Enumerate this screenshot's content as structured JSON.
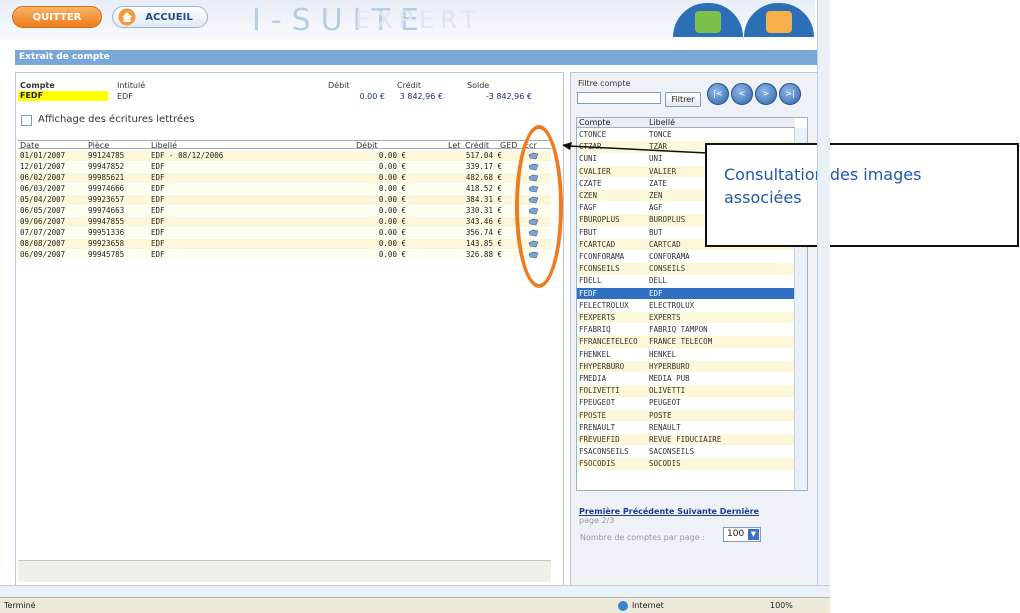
{
  "header": {
    "quit_label": "QUITTER",
    "home_label": "ACCUEIL",
    "brand": "I-SUITE",
    "brand_sub": "EXPERT"
  },
  "page": {
    "title": "Extrait de compte"
  },
  "account": {
    "labels": {
      "compte": "Compte",
      "intitule": "Intitulé",
      "debit": "Débit",
      "credit": "Crédit",
      "solde": "Solde"
    },
    "code": "FEDF",
    "name": "EDF",
    "debit": "0.00 €",
    "credit": "3 842,96 €",
    "solde": "-3 842,96 €"
  },
  "lettered_checkbox_label": "Affichage des écritures lettrées",
  "entries": {
    "columns": {
      "date": "Date",
      "piece": "Pièce",
      "libelle": "Libellé",
      "debit": "Débit",
      "let": "Let",
      "credit": "Crédit",
      "ged": "GED",
      "ecr": "Ecr"
    },
    "rows": [
      {
        "date": "01/01/2007",
        "piece": "99124785",
        "libelle": "EDF - 08/12/2006",
        "debit": "0.00 €",
        "credit": "517.04 €"
      },
      {
        "date": "12/01/2007",
        "piece": "99947852",
        "libelle": "EDF",
        "debit": "0.00 €",
        "credit": "339.17 €"
      },
      {
        "date": "06/02/2007",
        "piece": "99985621",
        "libelle": "EDF",
        "debit": "0.00 €",
        "credit": "482.68 €"
      },
      {
        "date": "06/03/2007",
        "piece": "99974666",
        "libelle": "EDF",
        "debit": "0.00 €",
        "credit": "418.52 €"
      },
      {
        "date": "05/04/2007",
        "piece": "99923657",
        "libelle": "EDF",
        "debit": "0.00 €",
        "credit": "384.31 €"
      },
      {
        "date": "06/05/2007",
        "piece": "99974663",
        "libelle": "EDF",
        "debit": "0.00 €",
        "credit": "330.31 €"
      },
      {
        "date": "09/06/2007",
        "piece": "99947855",
        "libelle": "EDF",
        "debit": "0.00 €",
        "credit": "343.46 €"
      },
      {
        "date": "07/07/2007",
        "piece": "99951336",
        "libelle": "EDF",
        "debit": "0.00 €",
        "credit": "356.74 €"
      },
      {
        "date": "08/08/2007",
        "piece": "99923658",
        "libelle": "EDF",
        "debit": "0.00 €",
        "credit": "143.85 €"
      },
      {
        "date": "06/09/2007",
        "piece": "99945785",
        "libelle": "EDF",
        "debit": "0.00 €",
        "credit": "326.88 €"
      }
    ]
  },
  "filter": {
    "label": "Filtre compte",
    "button": "Filtrer",
    "input_value": ""
  },
  "account_list": {
    "columns": {
      "compte": "Compte",
      "libelle": "Libellé"
    },
    "selected_code": "FEDF",
    "rows": [
      {
        "code": "CTONCE",
        "label": "TONCE"
      },
      {
        "code": "CTZAR",
        "label": "TZAR"
      },
      {
        "code": "CUNI",
        "label": "UNI"
      },
      {
        "code": "CVALIER",
        "label": "VALIER"
      },
      {
        "code": "CZATE",
        "label": "ZATE"
      },
      {
        "code": "CZEN",
        "label": "ZEN"
      },
      {
        "code": "FAGF",
        "label": "AGF"
      },
      {
        "code": "FBUROPLUS",
        "label": "BUROPLUS"
      },
      {
        "code": "FBUT",
        "label": "BUT"
      },
      {
        "code": "FCARTCAD",
        "label": "CARTCAD"
      },
      {
        "code": "FCONFORAMA",
        "label": "CONFORAMA"
      },
      {
        "code": "FCONSEILS",
        "label": "CONSEILS"
      },
      {
        "code": "FDELL",
        "label": "DELL"
      },
      {
        "code": "FEDF",
        "label": "EDF"
      },
      {
        "code": "FELECTROLUX",
        "label": "ELECTROLUX"
      },
      {
        "code": "FEXPERTS",
        "label": "EXPERTS"
      },
      {
        "code": "FFABRIQ",
        "label": "FABRIQ TAMPON"
      },
      {
        "code": "FFRANCETELECO",
        "label": "FRANCE TELECOM"
      },
      {
        "code": "FHENKEL",
        "label": "HENKEL"
      },
      {
        "code": "FHYPERBURO",
        "label": "HYPERBURO"
      },
      {
        "code": "FMEDIA",
        "label": "MEDIA PUB"
      },
      {
        "code": "FOLIVETTI",
        "label": "OLIVETTI"
      },
      {
        "code": "FPEUGEOT",
        "label": "PEUGEOT"
      },
      {
        "code": "FPOSTE",
        "label": "POSTE"
      },
      {
        "code": "FRENAULT",
        "label": "RENAULT"
      },
      {
        "code": "FREVUEFID",
        "label": "REVUE FIDUCIAIRE"
      },
      {
        "code": "FSACONSEILS",
        "label": "SACONSEILS"
      },
      {
        "code": "FSOCODIS",
        "label": "SOCODIS"
      }
    ]
  },
  "pager": {
    "first": "Première",
    "prev": "Précédente",
    "next": "Suivante",
    "last": "Dernière",
    "page": "page 2/3",
    "per_page_label": "Nombre de comptes par page :",
    "per_page_value": "100"
  },
  "callout": {
    "line1": "Consultation des images",
    "line2": "associées"
  },
  "status": {
    "left": "Terminé",
    "zone": "Internet",
    "zoom": "100%"
  },
  "colors": {
    "accent_blue": "#2d6fb7",
    "highlight_yellow": "#ffff00",
    "callout_orange": "#f07a1f",
    "callout_text": "#1f56b0"
  }
}
